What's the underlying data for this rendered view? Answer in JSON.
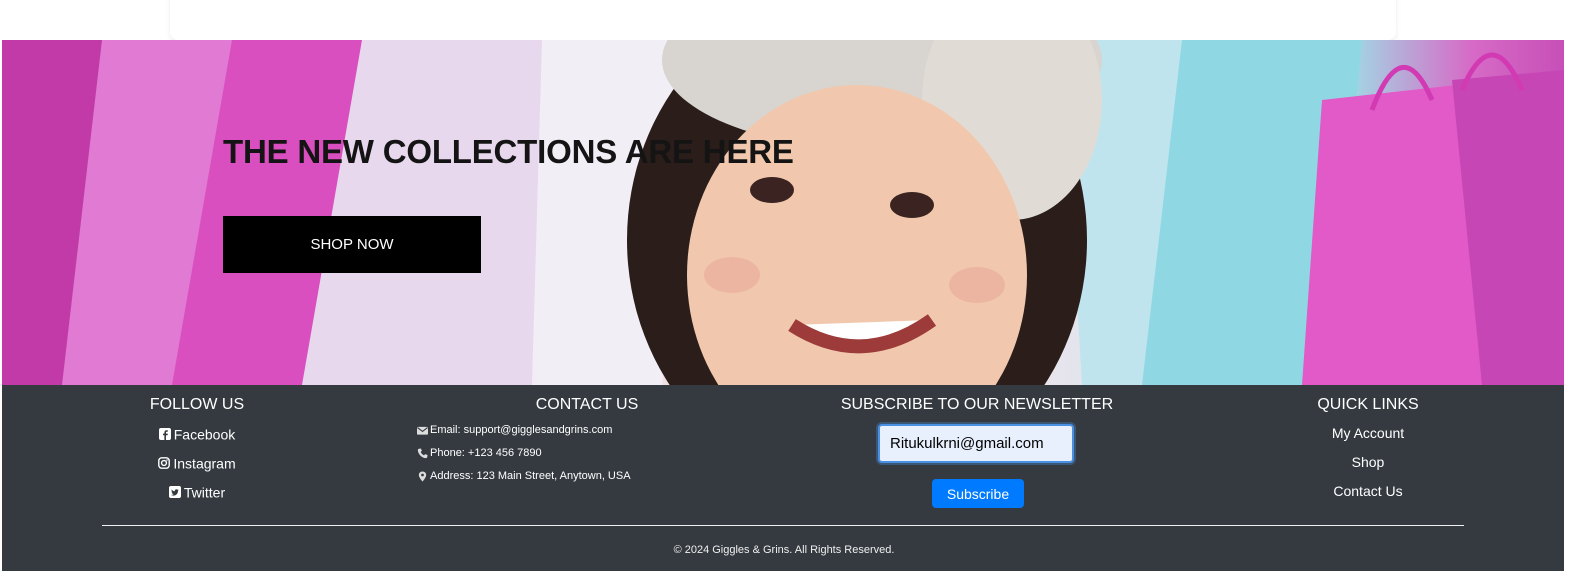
{
  "hero": {
    "title": "THE NEW COLLECTIONS ARE HERE",
    "cta_label": "SHOP NOW"
  },
  "footer": {
    "follow": {
      "heading": "FOLLOW US",
      "links": [
        {
          "label": "Facebook",
          "icon": "facebook-icon"
        },
        {
          "label": "Instagram",
          "icon": "instagram-icon"
        },
        {
          "label": "Twitter",
          "icon": "twitter-icon"
        }
      ]
    },
    "contact": {
      "heading": "CONTACT US",
      "email": "Email: support@gigglesandgrins.com",
      "phone": "Phone: +123 456 7890",
      "address": "Address: 123 Main Street, Anytown, USA"
    },
    "newsletter": {
      "heading": "SUBSCRIBE TO OUR NEWSLETTER",
      "email_value": "Ritukulkrni@gmail.com",
      "button_label": "Subscribe"
    },
    "quick_links": {
      "heading": "QUICK LINKS",
      "links": [
        "My Account",
        "Shop",
        "Contact Us"
      ]
    },
    "copyright": "© 2024 Giggles & Grins. All Rights Reserved."
  },
  "colors": {
    "footer_bg": "#343a40",
    "primary_button": "#007bff",
    "cta_bg": "#000000"
  }
}
